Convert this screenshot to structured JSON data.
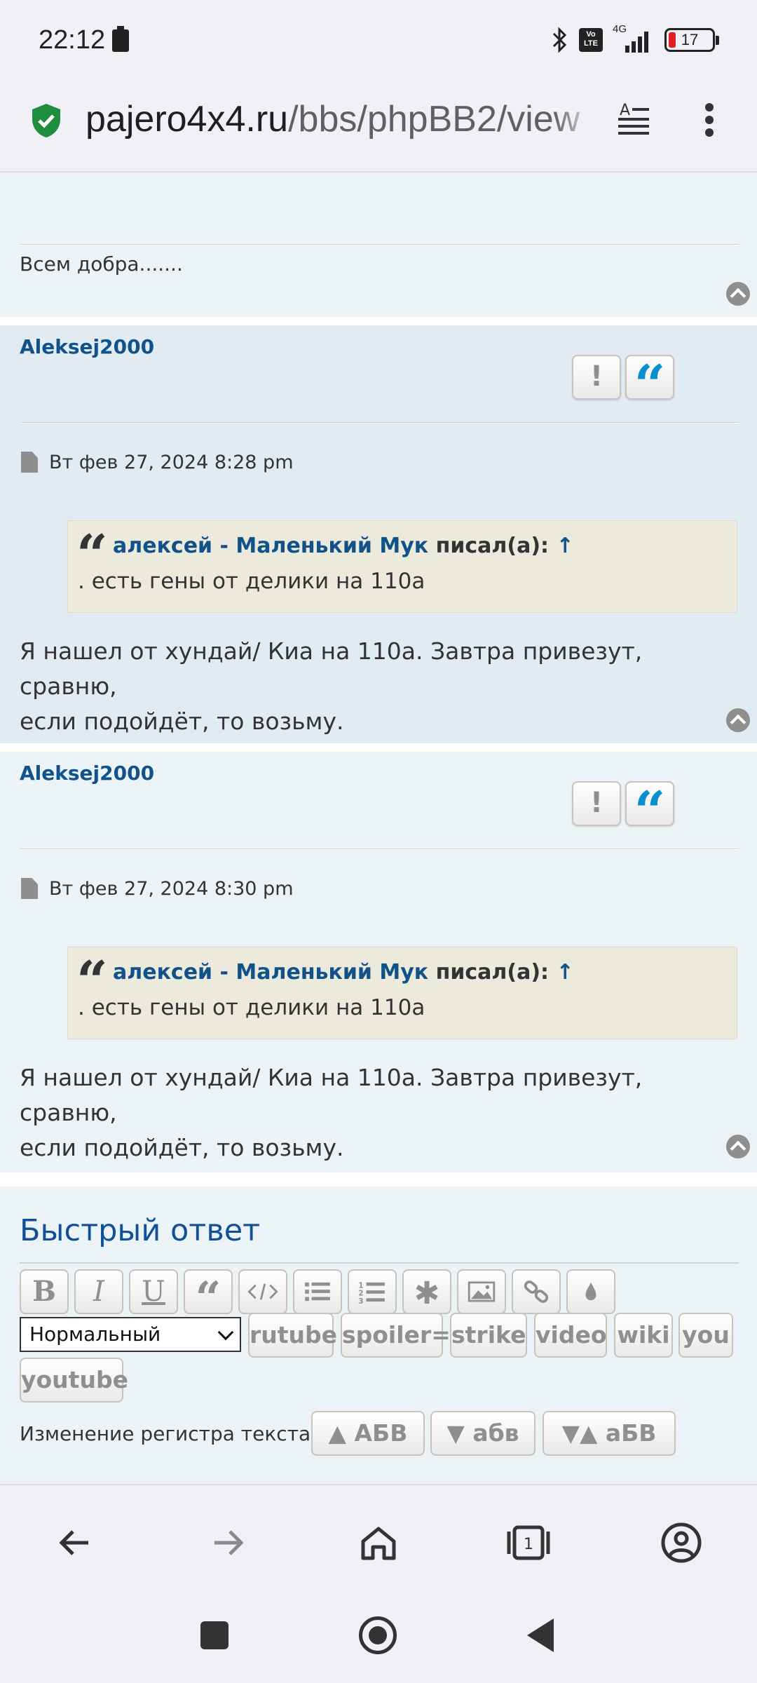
{
  "status_bar": {
    "time": "22:12",
    "network": "4G",
    "volte": "Vo LTE",
    "battery": "17"
  },
  "browser": {
    "url_host": "pajero4x4.ru",
    "url_path": "/bbs/phpBB2/view"
  },
  "prev_post": {
    "text": "Всем добра......."
  },
  "posts": [
    {
      "author": "Aleksej2000",
      "date": "Вт фев 27, 2024 8:28 pm",
      "quote_author": "алексей - Маленький Мук",
      "quote_wrote": "писал(а):",
      "quote_arrow": "↑",
      "quote_text": ". есть гены от делики на 110а",
      "body_line1": "Я нашел от хундай/ Киа на 110а. Завтра привезут, сравню,",
      "body_line2": "если подойдёт, то возьму."
    },
    {
      "author": "Aleksej2000",
      "date": "Вт фев 27, 2024 8:30 pm",
      "quote_author": "алексей - Маленький Мук",
      "quote_wrote": "писал(а):",
      "quote_arrow": "↑",
      "quote_text": ". есть гены от делики на 110а",
      "body_line1": "Я нашел от хундай/ Киа на 110а. Завтра привезут, сравню,",
      "body_line2": "если подойдёт, то возьму."
    }
  ],
  "quick_reply": {
    "title": "Быстрый ответ",
    "toolbar_icons": [
      "bold-icon",
      "italic-icon",
      "underline-icon",
      "quote-icon",
      "code-icon",
      "list-icon",
      "numbered-list-icon",
      "asterisk-icon",
      "image-icon",
      "link-icon",
      "color-drop-icon"
    ],
    "bold": "B",
    "italic": "I",
    "underline": "U",
    "font_size_select": "Нормальный",
    "tag_buttons": [
      "rutube",
      "spoiler=",
      "strike",
      "video",
      "wiki",
      "you",
      "youtube"
    ],
    "case_label": "Изменение регистра текста:",
    "case_buttons": [
      "▲ АБВ",
      "▼ абв",
      "▼▲ аБВ"
    ]
  },
  "colors": {
    "link": "#105289",
    "post_bg_a": "#e1ebf2",
    "post_bg_b": "#ecf3f7",
    "quote_bg": "#ebeadd",
    "quote_icon": "#0a8ed0",
    "secure_shield": "#1e8e3e"
  }
}
